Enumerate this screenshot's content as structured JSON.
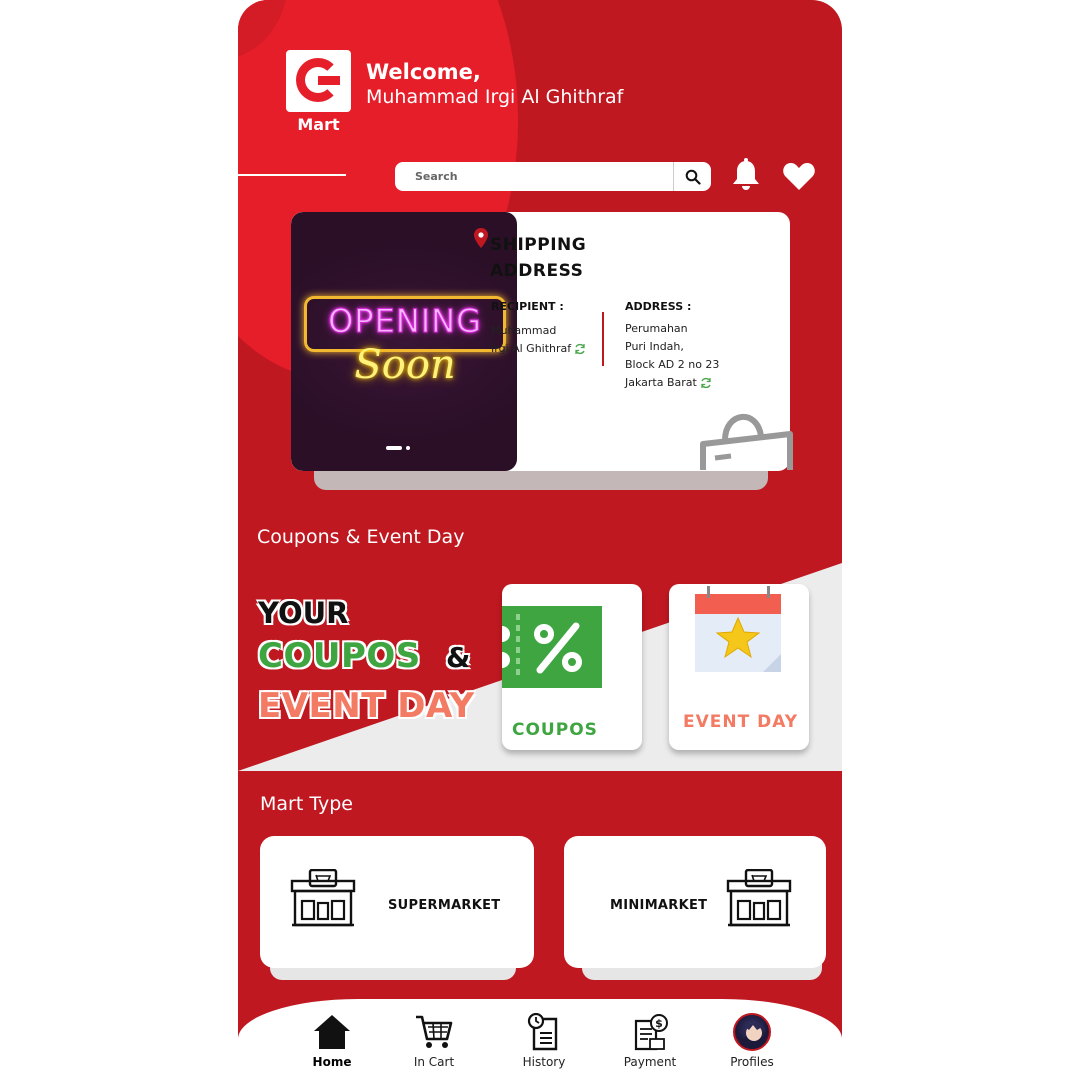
{
  "brand": {
    "name": "Mart"
  },
  "header": {
    "welcome": "Welcome,",
    "user_name": "Muhammad Irgi Al Ghithraf"
  },
  "search": {
    "placeholder": "Search"
  },
  "banner": {
    "line1": "OPENING",
    "line2": "Soon"
  },
  "shipping": {
    "title_line1": "SHIPPING",
    "title_line2": "ADDRESS",
    "recipient_label": "RECIPIENT :",
    "recipient_line1": "Muhammad",
    "recipient_line2": "Irgi Al Ghithraf",
    "address_label": "ADDRESS :",
    "address_line1": "Perumahan",
    "address_line2": "Puri Indah,",
    "address_line3": "Block AD 2 no 23",
    "address_line4": "Jakarta Barat"
  },
  "coupons_section": {
    "title": "Coupons & Event Day",
    "promo_line1": "YOUR",
    "promo_coupos": "COUPOS",
    "promo_amp": "&",
    "promo_event": "EVENT DAY",
    "card_coupos_label": "COUPOS",
    "card_event_label": "EVENT DAY"
  },
  "mart_section": {
    "title": "Mart Type",
    "supermarket_label": "SUPERMARKET",
    "minimarket_label": "MINIMARKET"
  },
  "nav": {
    "home": "Home",
    "cart": "In Cart",
    "history": "History",
    "payment": "Payment",
    "profiles": "Profiles"
  },
  "colors": {
    "primary_red": "#c01820",
    "bright_red": "#e61e2a",
    "coupos_green": "#3ea540",
    "event_orange": "#f37a63"
  },
  "icons": [
    "search-icon",
    "bell-icon",
    "heart-icon",
    "location-pin-icon",
    "refresh-icon",
    "shopping-bag-icon",
    "coupon-percent-icon",
    "calendar-star-icon",
    "store-icon",
    "home-icon",
    "cart-icon",
    "history-icon",
    "payment-icon"
  ]
}
